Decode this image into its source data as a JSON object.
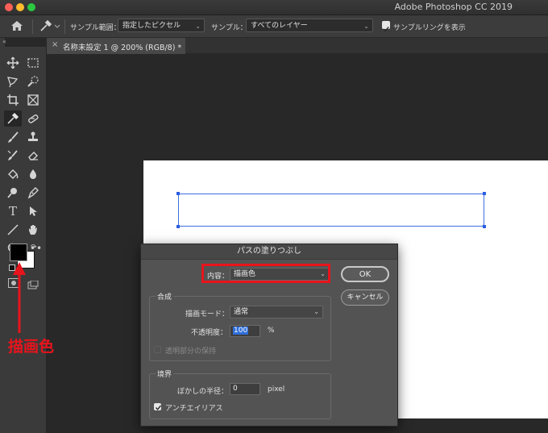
{
  "app": {
    "title": "Adobe Photoshop CC 2019"
  },
  "options_bar": {
    "sample_size_label": "サンプル範囲：",
    "sample_size_value": "指定したピクセル",
    "sample_label": "サンプル：",
    "sample_value": "すべてのレイヤー",
    "show_ring_label": "サンプルリングを表示",
    "show_ring_checked": true
  },
  "tab": {
    "close": "×",
    "title": "名称未設定 1 @ 200% (RGB/8) *"
  },
  "tools": [
    "move-tool",
    "marquee-tool",
    "lasso-tool",
    "quick-select-tool",
    "crop-tool",
    "frame-tool",
    "eyedropper-tool",
    "healing-tool",
    "brush-tool",
    "stamp-tool",
    "history-brush-tool",
    "eraser-tool",
    "paint-bucket-tool",
    "blur-tool",
    "dodge-tool",
    "pen-tool",
    "type-tool",
    "path-select-tool",
    "line-tool",
    "hand-tool",
    "zoom-tool",
    "more-tools"
  ],
  "colors": {
    "foreground": "#000000",
    "background": "#ffffff",
    "annotation": "#e8141c",
    "path": "#3d6fe0"
  },
  "dialog": {
    "title": "パスの塗りつぶし",
    "content_label": "内容：",
    "content_value": "描画色",
    "ok": "OK",
    "cancel": "キャンセル",
    "blend_group": "合成",
    "mode_label": "描画モード：",
    "mode_value": "通常",
    "opacity_label": "不透明度：",
    "opacity_value": "100",
    "opacity_unit": "%",
    "preserve_label": "透明部分の保持",
    "preserve_checked": false,
    "render_group": "境界",
    "feather_label": "ぼかしの半径：",
    "feather_value": "0",
    "feather_unit": "pixel",
    "antialias_label": "アンチエイリアス",
    "antialias_checked": true
  },
  "annotation": {
    "label": "描画色"
  }
}
